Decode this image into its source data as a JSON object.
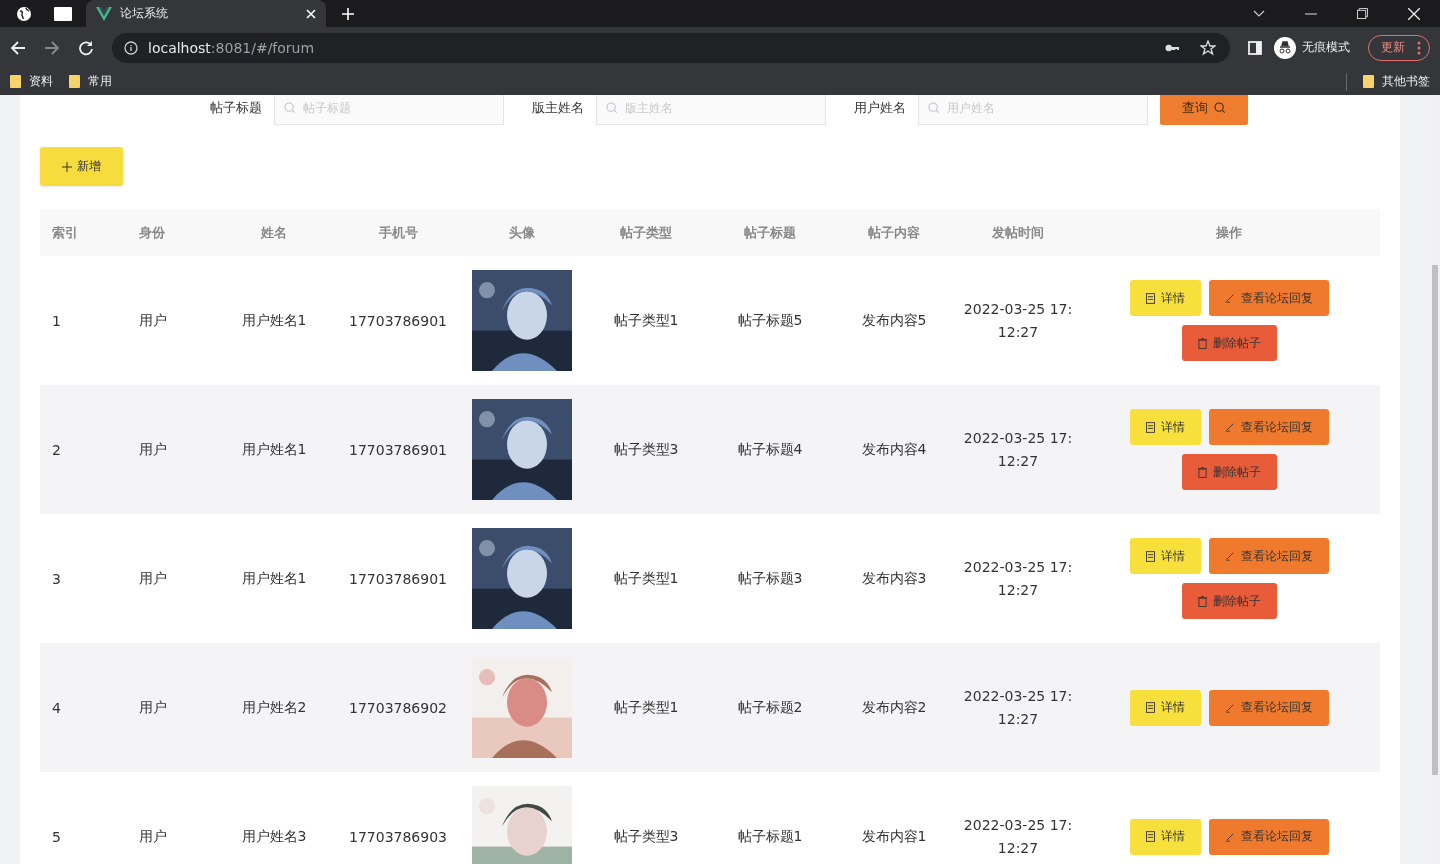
{
  "browser": {
    "tab_title": "论坛系统",
    "address_host": "localhost",
    "address_rest": ":8081/#/forum",
    "profile_label": "无痕模式",
    "update_label": "更新",
    "bookmarks": [
      "资料",
      "常用"
    ],
    "other_bookmarks": "其他书签"
  },
  "search": {
    "fields": [
      {
        "label": "帖子标题",
        "placeholder": "帖子标题"
      },
      {
        "label": "版主姓名",
        "placeholder": "版主姓名"
      },
      {
        "label": "用户姓名",
        "placeholder": "用户姓名"
      }
    ],
    "button": "查询"
  },
  "add_button": "新增",
  "table": {
    "columns": [
      "索引",
      "身份",
      "姓名",
      "手机号",
      "头像",
      "帖子类型",
      "帖子标题",
      "帖子内容",
      "发帖时间",
      "操作"
    ],
    "rows": [
      {
        "index": "1",
        "role": "用户",
        "name": "用户姓名1",
        "phone": "17703786901",
        "avatar": {
          "kind": "picture"
        },
        "type": "帖子类型1",
        "title": "帖子标题5",
        "content": "发布内容5",
        "time": "2022-03-25 17:12:27",
        "actions": [
          {
            "kind": "detail",
            "label": "详情"
          },
          {
            "kind": "replies",
            "label": "查看论坛回复"
          },
          {
            "kind": "delete",
            "label": "删除帖子"
          }
        ]
      },
      {
        "index": "2",
        "role": "用户",
        "name": "用户姓名1",
        "phone": "17703786901",
        "avatar": {
          "kind": "picture"
        },
        "type": "帖子类型3",
        "title": "帖子标题4",
        "content": "发布内容4",
        "time": "2022-03-25 17:12:27",
        "actions": [
          {
            "kind": "detail",
            "label": "详情"
          },
          {
            "kind": "replies",
            "label": "查看论坛回复"
          },
          {
            "kind": "delete",
            "label": "删除帖子"
          }
        ]
      },
      {
        "index": "3",
        "role": "用户",
        "name": "用户姓名1",
        "phone": "17703786901",
        "avatar": {
          "kind": "picture"
        },
        "type": "帖子类型1",
        "title": "帖子标题3",
        "content": "发布内容3",
        "time": "2022-03-25 17:12:27",
        "actions": [
          {
            "kind": "detail",
            "label": "详情"
          },
          {
            "kind": "replies",
            "label": "查看论坛回复"
          },
          {
            "kind": "delete",
            "label": "删除帖子"
          }
        ]
      },
      {
        "index": "4",
        "role": "用户",
        "name": "用户姓名2",
        "phone": "17703786902",
        "avatar": {
          "kind": "picture"
        },
        "type": "帖子类型1",
        "title": "帖子标题2",
        "content": "发布内容2",
        "time": "2022-03-25 17:12:27",
        "actions": [
          {
            "kind": "detail",
            "label": "详情"
          },
          {
            "kind": "replies",
            "label": "查看论坛回复"
          }
        ]
      },
      {
        "index": "5",
        "role": "用户",
        "name": "用户姓名3",
        "phone": "17703786903",
        "avatar": {
          "kind": "picture"
        },
        "type": "帖子类型3",
        "title": "帖子标题1",
        "content": "发布内容1",
        "time": "2022-03-25 17:12:27",
        "actions": [
          {
            "kind": "detail",
            "label": "详情"
          },
          {
            "kind": "replies",
            "label": "查看论坛回复"
          }
        ]
      }
    ]
  }
}
